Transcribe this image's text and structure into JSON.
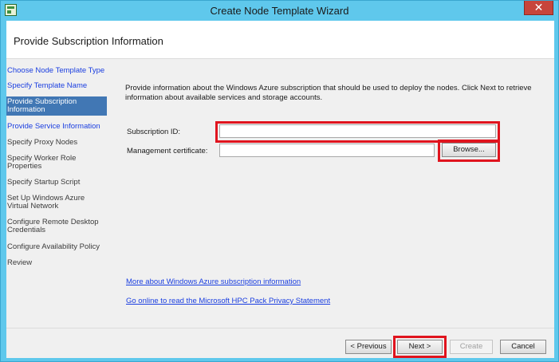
{
  "window": {
    "title": "Create Node Template Wizard",
    "close_glyph": "✕"
  },
  "header": {
    "title": "Provide Subscription Information"
  },
  "sidebar": {
    "steps": [
      {
        "label": "Choose Node Template Type",
        "state": "done"
      },
      {
        "label": "Specify Template Name",
        "state": "done"
      },
      {
        "label": "Provide Subscription Information",
        "state": "active"
      },
      {
        "label": "Provide Service Information",
        "state": "done"
      },
      {
        "label": "Specify Proxy Nodes",
        "state": "pending"
      },
      {
        "label": "Specify Worker Role Properties",
        "state": "pending"
      },
      {
        "label": "Specify Startup Script",
        "state": "pending"
      },
      {
        "label": "Set Up Windows Azure Virtual Network",
        "state": "pending"
      },
      {
        "label": "Configure Remote Desktop Credentials",
        "state": "pending"
      },
      {
        "label": "Configure Availability Policy",
        "state": "pending"
      },
      {
        "label": "Review",
        "state": "pending"
      }
    ]
  },
  "main": {
    "intro": "Provide information about the Windows Azure subscription that should be used to deploy the nodes. Click Next to retrieve information about available services and storage accounts.",
    "subscription_id": {
      "label": "Subscription ID:",
      "value": ""
    },
    "management_certificate": {
      "label": "Management certificate:",
      "value": "",
      "browse_label": "Browse..."
    },
    "links": {
      "more_info": "More about Windows Azure subscription information",
      "privacy": "Go online to read the Microsoft HPC Pack Privacy Statement"
    }
  },
  "footer": {
    "previous_label": "< Previous",
    "next_label": "Next >",
    "create_label": "Create",
    "cancel_label": "Cancel"
  },
  "colors": {
    "title_bar": "#5fc8ec",
    "active_step": "#4177b4",
    "link": "#1a3ee0",
    "highlight": "#e0141e"
  }
}
